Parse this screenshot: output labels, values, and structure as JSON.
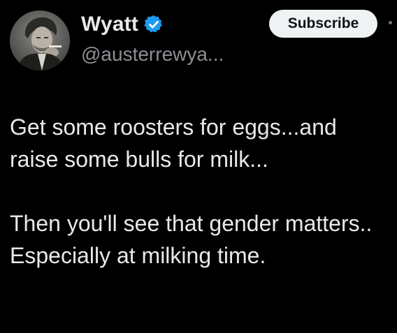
{
  "user": {
    "display_name": "Wyatt",
    "handle": "@austerrewya...",
    "verified_icon": "verified-badge-icon",
    "verified_color": "#1d9bf0"
  },
  "actions": {
    "subscribe_label": "Subscribe",
    "more_icon": "more-dots-icon"
  },
  "tweet": {
    "paragraphs": [
      "Get some roosters for eggs...and raise some bulls for milk...",
      "Then you'll see that gender matters.. Especially at milking time."
    ]
  },
  "colors": {
    "background": "#000000",
    "text": "#e7e9ea",
    "handle": "#8b8f94",
    "button_bg": "#eff3f4",
    "button_text": "#0f1419"
  }
}
